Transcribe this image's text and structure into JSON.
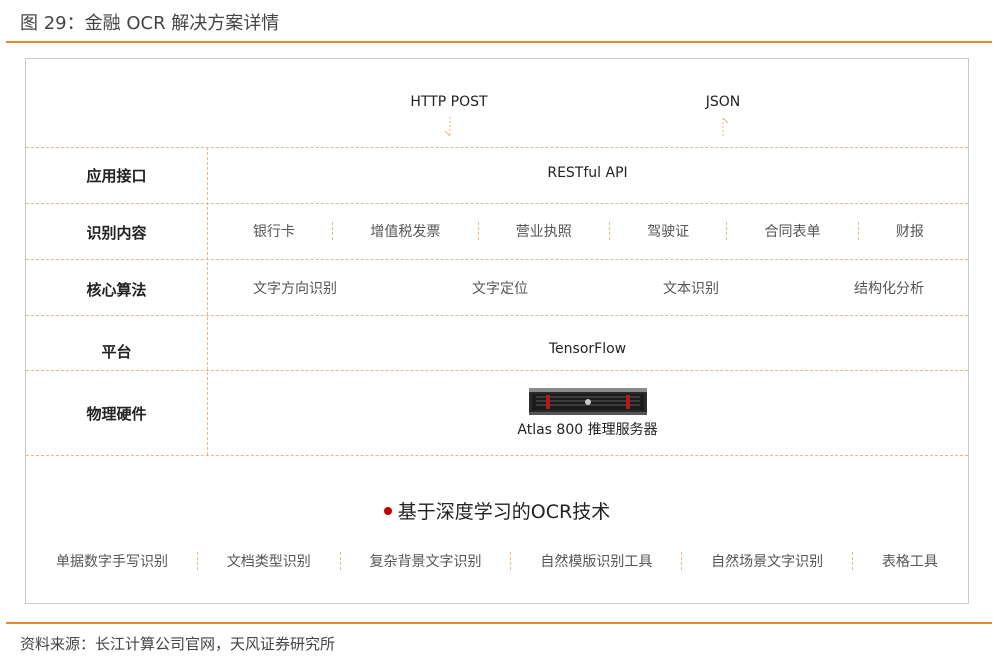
{
  "figure_title": "图 29：金融 OCR 解决方案详情",
  "source": "资料来源：长江计算公司官网，天风证券研究所",
  "io": {
    "request": "HTTP POST",
    "response": "JSON"
  },
  "rows": {
    "app_interface": {
      "label": "应用接口",
      "value": "RESTful  API"
    },
    "recognition": {
      "label": "识别内容",
      "items": [
        "银行卡",
        "增值税发票",
        "营业执照",
        "驾驶证",
        "合同表单",
        "财报"
      ]
    },
    "algorithms": {
      "label": "核心算法",
      "items": [
        "文字方向识别",
        "文字定位",
        "文本识别",
        "结构化分析"
      ]
    },
    "platform": {
      "label": "平台",
      "value": "TensorFlow"
    },
    "hardware": {
      "label": "物理硬件",
      "value": "Atlas 800 推理服务器"
    }
  },
  "bottom": {
    "title": "基于深度学习的OCR技术",
    "items": [
      "单据数字手写识别",
      "文档类型识别",
      "复杂背景文字识别",
      "自然模版识别工具",
      "自然场景文字识别",
      "表格工具"
    ]
  },
  "colors": {
    "accent_rule": "#e8892f",
    "dashed": "#e3b88a",
    "bullet": "#c00000"
  }
}
